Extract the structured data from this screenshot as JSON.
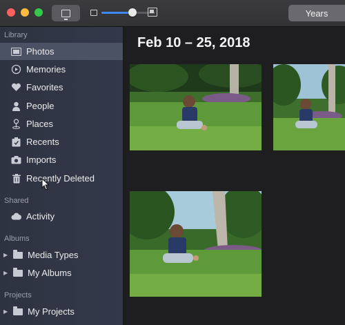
{
  "toolbar": {
    "years_label": "Years",
    "zoom_level": 0.58
  },
  "sidebar": {
    "sections": {
      "library": "Library",
      "shared": "Shared",
      "albums": "Albums",
      "projects": "Projects"
    },
    "items": {
      "photos": "Photos",
      "memories": "Memories",
      "favorites": "Favorites",
      "people": "People",
      "places": "Places",
      "recents": "Recents",
      "imports": "Imports",
      "recently_deleted": "Recently Deleted",
      "activity": "Activity",
      "media_types": "Media Types",
      "my_albums": "My Albums",
      "my_projects": "My Projects"
    },
    "selected": "photos"
  },
  "main": {
    "date_range": "Feb 10 – 25, 2018"
  },
  "colors": {
    "accent": "#3d8af7",
    "sidebar_selected": "#4a5264"
  }
}
